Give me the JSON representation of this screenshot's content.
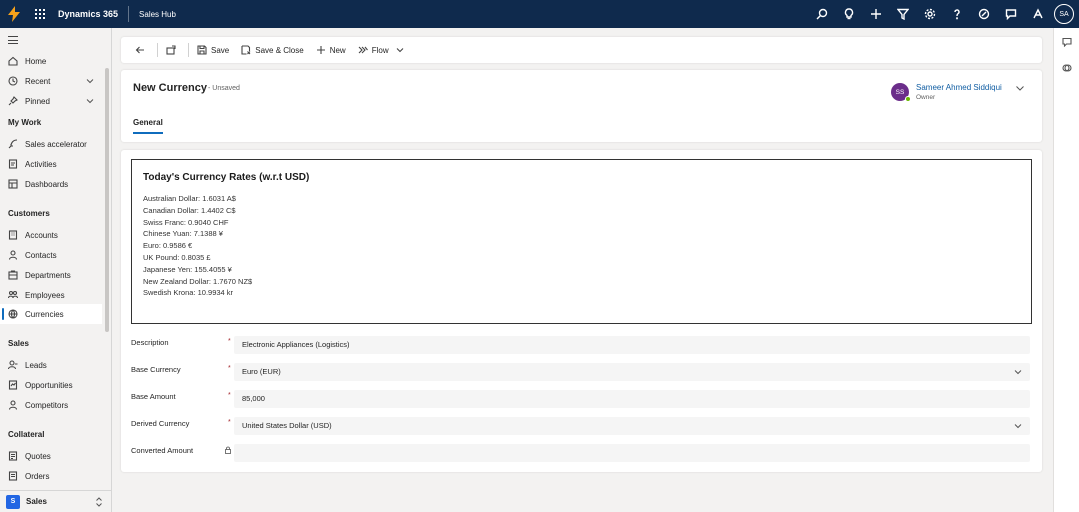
{
  "topbar": {
    "app_name": "Dynamics 365",
    "hub_name": "Sales Hub",
    "user_initials": "SA",
    "icons": [
      "search-icon",
      "lightbulb-icon",
      "plus-icon",
      "filter-icon",
      "gear-icon",
      "help-icon",
      "remote-assistance-icon",
      "chat-icon",
      "copilot-icon"
    ]
  },
  "sidebar": {
    "items_top": [
      {
        "label": "Home",
        "icon": "home-icon"
      },
      {
        "label": "Recent",
        "icon": "clock-icon"
      },
      {
        "label": "Pinned",
        "icon": "pin-icon"
      }
    ],
    "sections": [
      {
        "title": "My Work",
        "items": [
          {
            "label": "Sales accelerator",
            "icon": "rocket-icon"
          },
          {
            "label": "Activities",
            "icon": "activities-icon"
          },
          {
            "label": "Dashboards",
            "icon": "dashboard-icon"
          }
        ]
      },
      {
        "title": "Customers",
        "items": [
          {
            "label": "Accounts",
            "icon": "building-icon"
          },
          {
            "label": "Contacts",
            "icon": "person-icon"
          },
          {
            "label": "Departments",
            "icon": "department-icon"
          },
          {
            "label": "Employees",
            "icon": "employees-icon"
          },
          {
            "label": "Currencies",
            "icon": "globe-icon"
          }
        ]
      },
      {
        "title": "Sales",
        "items": [
          {
            "label": "Leads",
            "icon": "leads-icon"
          },
          {
            "label": "Opportunities",
            "icon": "opportunity-icon"
          },
          {
            "label": "Competitors",
            "icon": "competitor-icon"
          }
        ]
      },
      {
        "title": "Collateral",
        "items": [
          {
            "label": "Quotes",
            "icon": "quote-icon"
          },
          {
            "label": "Orders",
            "icon": "order-icon"
          }
        ]
      }
    ],
    "footer": {
      "badge": "S",
      "label": "Sales"
    }
  },
  "commandbar": {
    "save": "Save",
    "save_close": "Save & Close",
    "new": "New",
    "flow": "Flow"
  },
  "header": {
    "title": "New Currency",
    "status": "- Unsaved",
    "owner_initials": "SS",
    "owner_name": "Sameer Ahmed Siddiqui",
    "owner_role": "Owner",
    "tab": "General"
  },
  "rates": {
    "title": "Today's Currency Rates (w.r.t USD)",
    "lines": [
      "Australian Dollar: 1.6031 A$",
      "Canadian Dollar: 1.4402 C$",
      "Swiss Franc: 0.9040 CHF",
      "Chinese Yuan: 7.1388 ¥",
      "Euro: 0.9586 €",
      "UK Pound: 0.8035 £",
      "Japanese Yen: 155.4055 ¥",
      "New Zealand Dollar: 1.7670 NZ$",
      "Swedish Krona: 10.9934 kr"
    ]
  },
  "form": {
    "description": {
      "label": "Description",
      "value": "Electronic Appliances (Logistics)"
    },
    "base_currency": {
      "label": "Base Currency",
      "value": "Euro (EUR)"
    },
    "base_amount": {
      "label": "Base Amount",
      "value": "85,000"
    },
    "derived_currency": {
      "label": "Derived Currency",
      "value": "United States Dollar (USD)"
    },
    "converted_amount": {
      "label": "Converted Amount",
      "value": ""
    },
    "required_mark": "*"
  },
  "colors": {
    "topbar": "#0f2a4d",
    "accent": "#0f6cbd",
    "owner_avatar": "#6b2d8a",
    "presence": "#6bb700"
  }
}
